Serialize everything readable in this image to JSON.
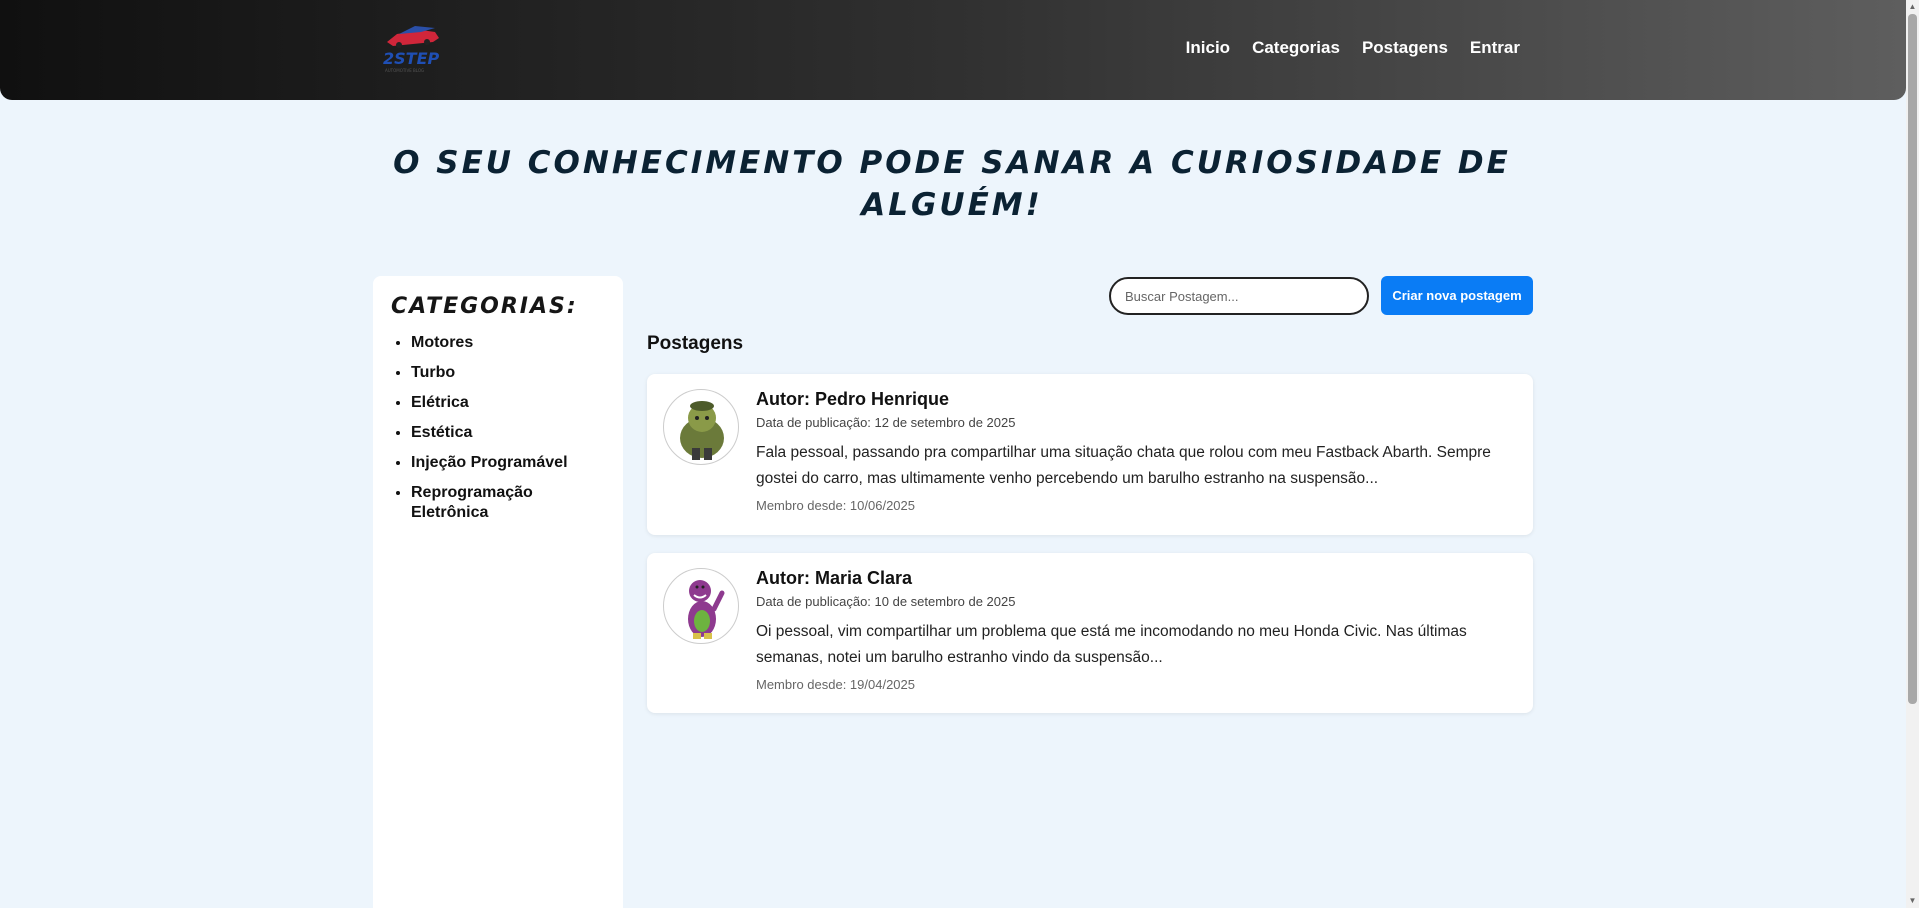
{
  "nav": {
    "items": [
      {
        "label": "Inicio"
      },
      {
        "label": "Categorias"
      },
      {
        "label": "Postagens"
      },
      {
        "label": "Entrar"
      }
    ]
  },
  "logo": {
    "text": "2STEP",
    "subtext": "AUTOMOTIVE BLOG"
  },
  "hero": {
    "title": "O seu conhecimento pode sanar a curiosidade de alguém!"
  },
  "sidebar": {
    "title": "Categorias:",
    "items": [
      {
        "label": "Motores"
      },
      {
        "label": "Turbo"
      },
      {
        "label": "Elétrica"
      },
      {
        "label": "Estética"
      },
      {
        "label": "Injeção Programável"
      },
      {
        "label": "Reprogramação Eletrônica"
      }
    ]
  },
  "search": {
    "placeholder": "Buscar Postagem..."
  },
  "actions": {
    "new_post_label": "Criar nova postagem"
  },
  "posts": {
    "title": "Postagens",
    "items": [
      {
        "author": "Autor: Pedro Henrique",
        "date": "Data de publicação: 12 de setembro de 2025",
        "excerpt": "Fala pessoal, passando pra compartilhar uma situação chata que rolou com meu Fastback Abarth. Sempre gostei do carro, mas ultimamente venho percebendo um barulho estranho na suspensão...",
        "member_since": "Membro desde: 10/06/2025",
        "avatar_color": "#6b7a3a"
      },
      {
        "author": "Autor: Maria Clara",
        "date": "Data de publicação: 10 de setembro de 2025",
        "excerpt": "Oi pessoal, vim compartilhar um problema que está me incomodando no meu Honda Civic. Nas últimas semanas, notei um barulho estranho vindo da suspensão...",
        "member_since": "Membro desde: 19/04/2025",
        "avatar_color": "#8e3a8f"
      }
    ]
  },
  "colors": {
    "accent": "#0a7cf5",
    "page_bg": "#edf5fc",
    "hero_text": "#0b2233"
  }
}
